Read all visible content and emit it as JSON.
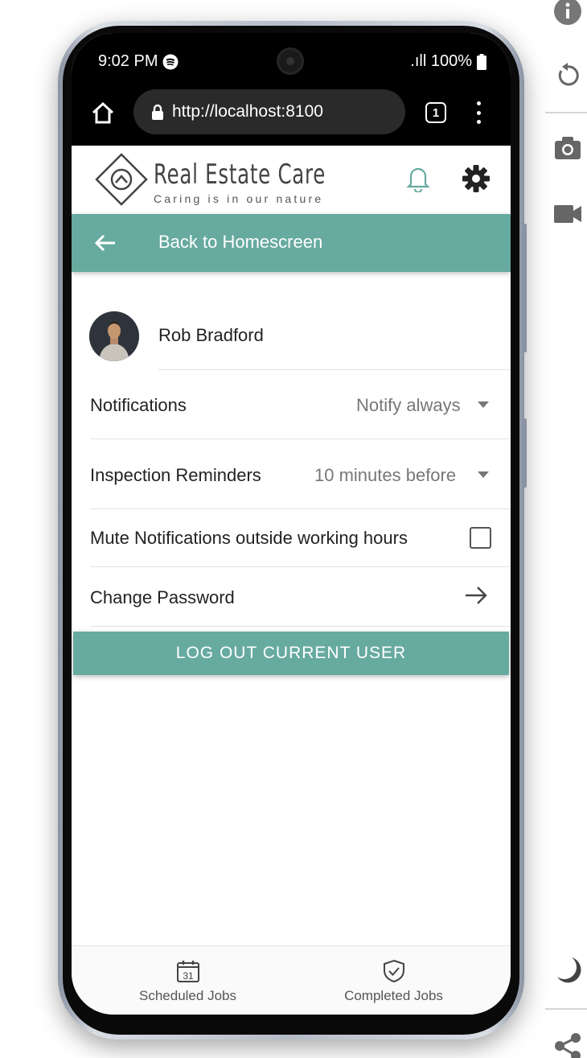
{
  "status_bar": {
    "time": "9:02 PM",
    "battery": ".ıll 100%"
  },
  "browser": {
    "url": "http://localhost:8100",
    "tab_count": "1"
  },
  "app": {
    "logo_title": "Real Estate Care",
    "logo_subtitle": "Caring is in our nature",
    "back_label": "Back to Homescreen",
    "accent_color": "#67aaa0"
  },
  "profile": {
    "user_name": "Rob Bradford"
  },
  "settings": {
    "notifications_label": "Notifications",
    "notifications_value": "Notify always",
    "reminders_label": "Inspection Reminders",
    "reminders_value": "10 minutes before",
    "mute_label": "Mute Notifications outside working hours",
    "mute_checked": false,
    "password_label": "Change Password",
    "logout_label": "LOG OUT CURRENT USER"
  },
  "bottom_tabs": {
    "scheduled_label": "Scheduled Jobs",
    "scheduled_icon_day": "31",
    "completed_label": "Completed Jobs"
  },
  "icons": [
    "info-icon",
    "rotate-icon",
    "camera-icon",
    "video-icon",
    "moon-icon",
    "share-icon",
    "home-icon",
    "lock-icon",
    "bell-icon",
    "gear-icon",
    "back-arrow-icon",
    "forward-arrow-icon",
    "calendar-icon",
    "shield-check-icon"
  ]
}
